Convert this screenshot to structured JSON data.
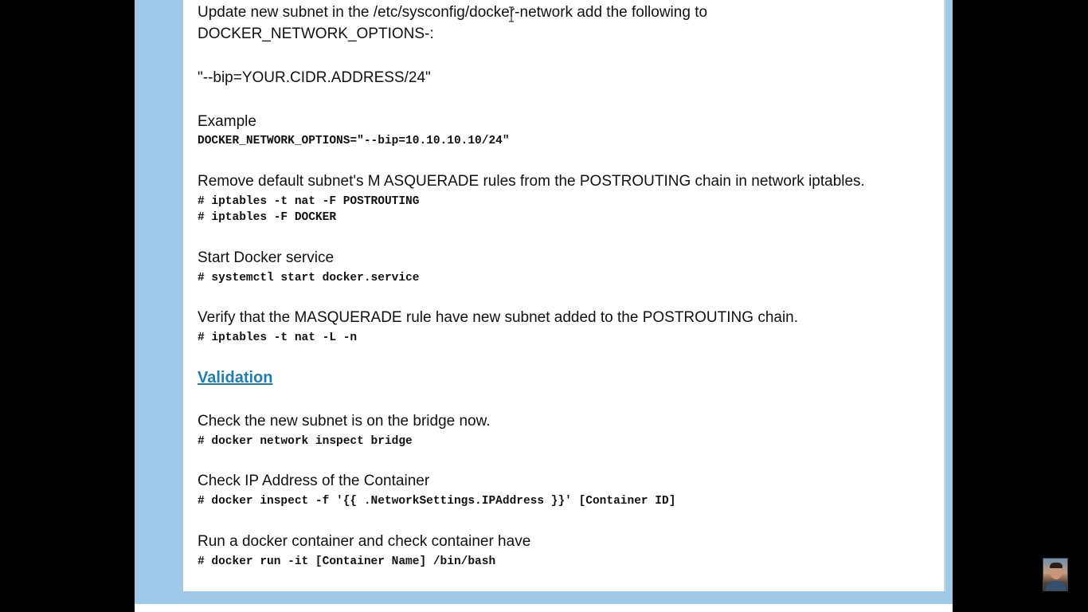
{
  "document": {
    "update_line1": "Update new subnet in the /etc/sysconfig/docker-network add the following to",
    "update_line2": "DOCKER_NETWORK_OPTIONS-:",
    "bip_value": "\"--bip=YOUR.CIDR.ADDRESS/24\"",
    "example_label": "Example",
    "example_code": "DOCKER_NETWORK_OPTIONS=\"--bip=10.10.10.10/24\"",
    "remove_text": "Remove default subnet's M ASQUERADE rules from the POSTROUTING chain in network iptables.",
    "remove_cmd1": "# iptables -t nat -F POSTROUTING",
    "remove_cmd2": "# iptables -F DOCKER",
    "start_text": "Start Docker service",
    "start_cmd": "# systemctl start docker.service",
    "verify_text": "Verify that the MASQUERADE rule have new subnet added to the POSTROUTING chain.",
    "verify_cmd": "# iptables -t nat -L -n",
    "validation_heading": "Validation",
    "check_subnet_text": "Check the new subnet is on the bridge now.",
    "check_subnet_cmd": "# docker network inspect bridge",
    "check_ip_text": "Check IP Address of the Container",
    "check_ip_cmd": "# docker inspect -f '{{ .NetworkSettings.IPAddress }}' [Container ID]",
    "run_text": "Run a docker container and check container have",
    "run_cmd": "# docker run -it [Container Name] /bin/bash"
  },
  "colors": {
    "frame_blue": "#9fc9e6",
    "link_blue": "#1f7fb0",
    "background": "#000000"
  },
  "icons": {
    "cursor": "i-beam-cursor-icon",
    "presenter": "presenter-avatar"
  }
}
